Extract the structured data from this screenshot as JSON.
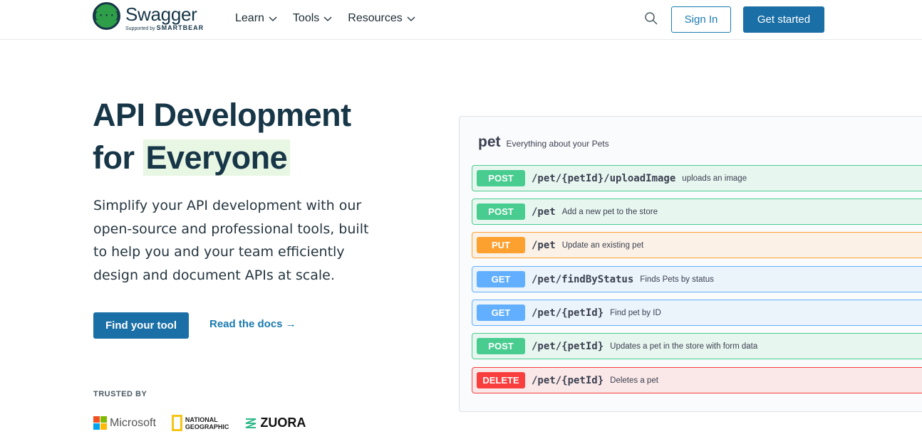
{
  "nav": {
    "logo_name": "Swagger",
    "logo_sub_prefix": "Supported by",
    "logo_sub_brand": "SMARTBEAR",
    "links": [
      {
        "label": "Learn"
      },
      {
        "label": "Tools"
      },
      {
        "label": "Resources"
      }
    ],
    "signin_label": "Sign In",
    "get_started_label": "Get started"
  },
  "hero": {
    "title_line1": "API Development",
    "title_line2_prefix": "for",
    "title_line2_highlight": "Everyone",
    "description": "Simplify your API development with our open-source and professional tools, built to help you and your team efficiently design and document APIs at scale.",
    "primary_button": "Find your tool",
    "secondary_link": "Read the docs →"
  },
  "trusted": {
    "label": "TRUSTED BY",
    "logos": [
      "Microsoft",
      "NATIONAL",
      "GEOGRAPHIC",
      "ZUORA"
    ]
  },
  "api_panel": {
    "tag": "pet",
    "tag_description": "Everything about your Pets",
    "operations": [
      {
        "method": "POST",
        "path": "/pet/{petId}/uploadImage",
        "summary": "uploads an image"
      },
      {
        "method": "POST",
        "path": "/pet",
        "summary": "Add a new pet to the store"
      },
      {
        "method": "PUT",
        "path": "/pet",
        "summary": "Update an existing pet"
      },
      {
        "method": "GET",
        "path": "/pet/findByStatus",
        "summary": "Finds Pets by status"
      },
      {
        "method": "GET",
        "path": "/pet/{petId}",
        "summary": "Find pet by ID"
      },
      {
        "method": "POST",
        "path": "/pet/{petId}",
        "summary": "Updates a pet in the store with form data"
      },
      {
        "method": "DELETE",
        "path": "/pet/{petId}",
        "summary": "Deletes a pet"
      }
    ]
  },
  "colors": {
    "brand_blue": "#1a6fa6",
    "post": "#49cc90",
    "put": "#fca130",
    "get": "#61affe",
    "delete": "#f93e3e"
  }
}
